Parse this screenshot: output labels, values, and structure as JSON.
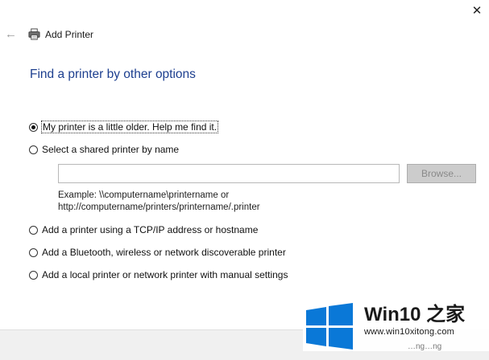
{
  "window": {
    "title": "Add Printer",
    "close_glyph": "✕",
    "back_glyph": "←"
  },
  "heading": "Find a printer by other options",
  "options": [
    {
      "label": "My printer is a little older. Help me find it.",
      "selected": true
    },
    {
      "label": "Select a shared printer by name",
      "selected": false
    },
    {
      "label": "Add a printer using a TCP/IP address or hostname",
      "selected": false
    },
    {
      "label": "Add a Bluetooth, wireless or network discoverable printer",
      "selected": false
    },
    {
      "label": "Add a local printer or network printer with manual settings",
      "selected": false
    }
  ],
  "shared_printer": {
    "input_value": "",
    "browse_label": "Browse...",
    "example_line1": "Example: \\\\computername\\printername or",
    "example_line2": "http://computername/printers/printername/.printer"
  },
  "watermark": {
    "brand": "Win10 之家",
    "url": "www.win10xitong.com",
    "partial_text": "…ng…ng"
  },
  "colors": {
    "heading": "#1d3f8f",
    "windows_logo": "#0a78d7",
    "footer": "#f0f0f0"
  }
}
